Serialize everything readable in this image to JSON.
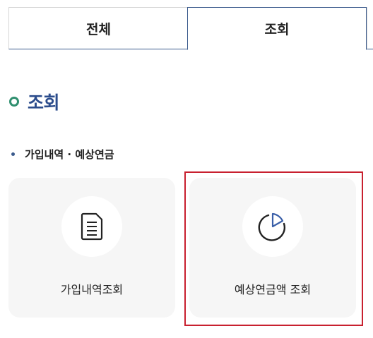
{
  "tabs": {
    "all_label": "전체",
    "inquiry_label": "조회",
    "active": "조회"
  },
  "page": {
    "title": "조회"
  },
  "section": {
    "heading": "가입내역 · 예상연금"
  },
  "cards": [
    {
      "label": "가입내역조회",
      "icon": "document-icon"
    },
    {
      "label": "예상연금액 조회",
      "icon": "pie-chart-icon"
    }
  ],
  "colors": {
    "accent_blue": "#2b4c8c",
    "tab_border": "#3a5a8c",
    "title_ring": "#2f8f6f",
    "highlight": "#c8202f",
    "card_bg": "#f6f6f6"
  }
}
